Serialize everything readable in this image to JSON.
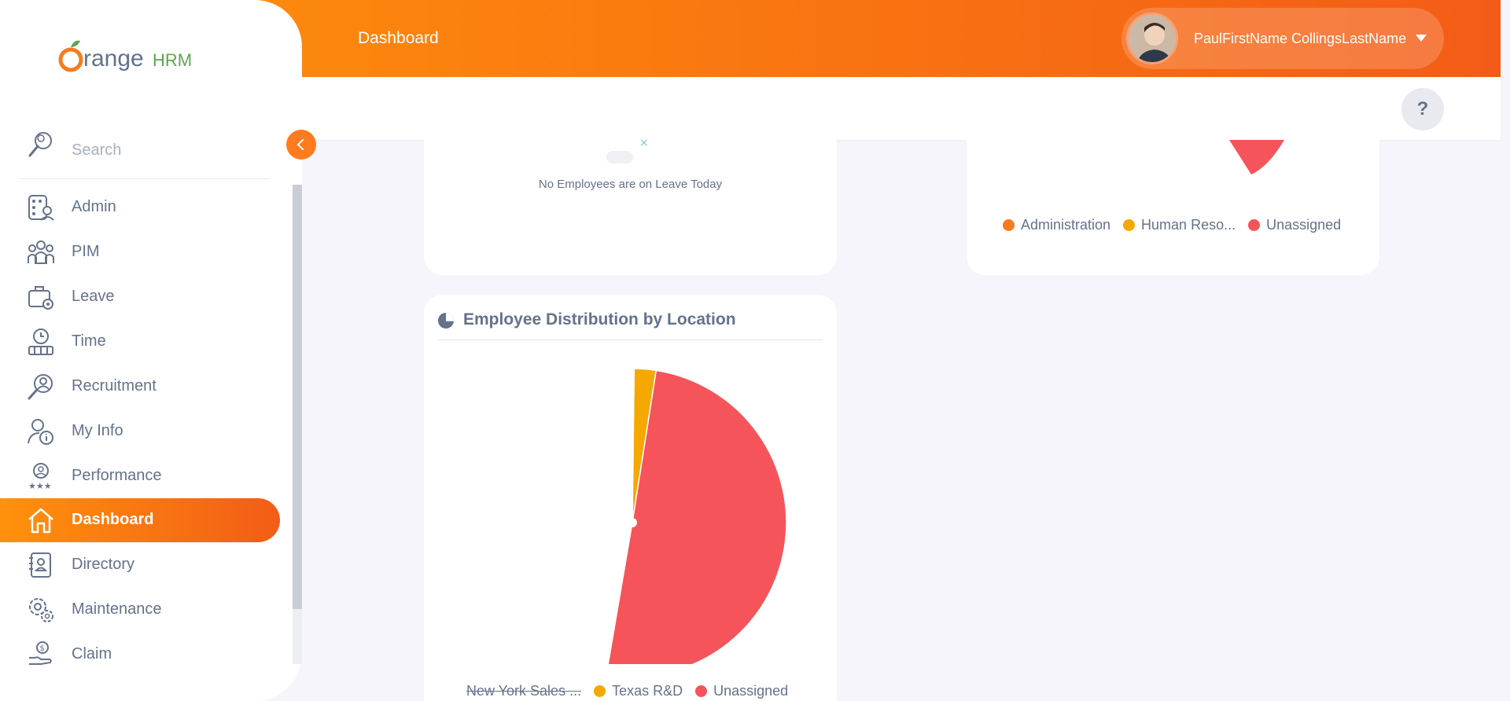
{
  "brand": {
    "logo_text_orange": "range",
    "logo_text_hrm": "HRM"
  },
  "header": {
    "title": "Dashboard",
    "user_name": "PaulFirstName CollingsLastName",
    "help_label": "?"
  },
  "sidebar": {
    "search_placeholder": "Search",
    "items": [
      {
        "label": "Admin",
        "icon": "admin-icon"
      },
      {
        "label": "PIM",
        "icon": "pim-icon"
      },
      {
        "label": "Leave",
        "icon": "leave-icon"
      },
      {
        "label": "Time",
        "icon": "time-icon"
      },
      {
        "label": "Recruitment",
        "icon": "recruitment-icon"
      },
      {
        "label": "My Info",
        "icon": "my-info-icon"
      },
      {
        "label": "Performance",
        "icon": "performance-icon"
      },
      {
        "label": "Dashboard",
        "icon": "home-icon",
        "active": true
      },
      {
        "label": "Directory",
        "icon": "directory-icon"
      },
      {
        "label": "Maintenance",
        "icon": "maintenance-icon"
      },
      {
        "label": "Claim",
        "icon": "claim-icon"
      }
    ]
  },
  "leave_widget": {
    "empty_text": "No Employees are on Leave Today"
  },
  "subunit_widget": {
    "legend": [
      {
        "label": "Administration",
        "color": "#f57c1f"
      },
      {
        "label": "Human Reso...",
        "color": "#f5a800"
      },
      {
        "label": "Unassigned",
        "color": "#f5545a"
      }
    ]
  },
  "location_widget": {
    "title": "Employee Distribution by Location",
    "legend": [
      {
        "label": "New York Sales ...",
        "color": "#a8b0bf",
        "hidden": true
      },
      {
        "label": "Texas R&D",
        "color": "#f5a800"
      },
      {
        "label": "Unassigned",
        "color": "#f5545a"
      }
    ]
  },
  "chart_data": {
    "type": "pie",
    "title": "Employee Distribution by Location",
    "categories": [
      "Texas R&D",
      "Unassigned"
    ],
    "values": [
      2,
      44
    ],
    "hidden_categories": [
      "New York Sales ..."
    ]
  }
}
